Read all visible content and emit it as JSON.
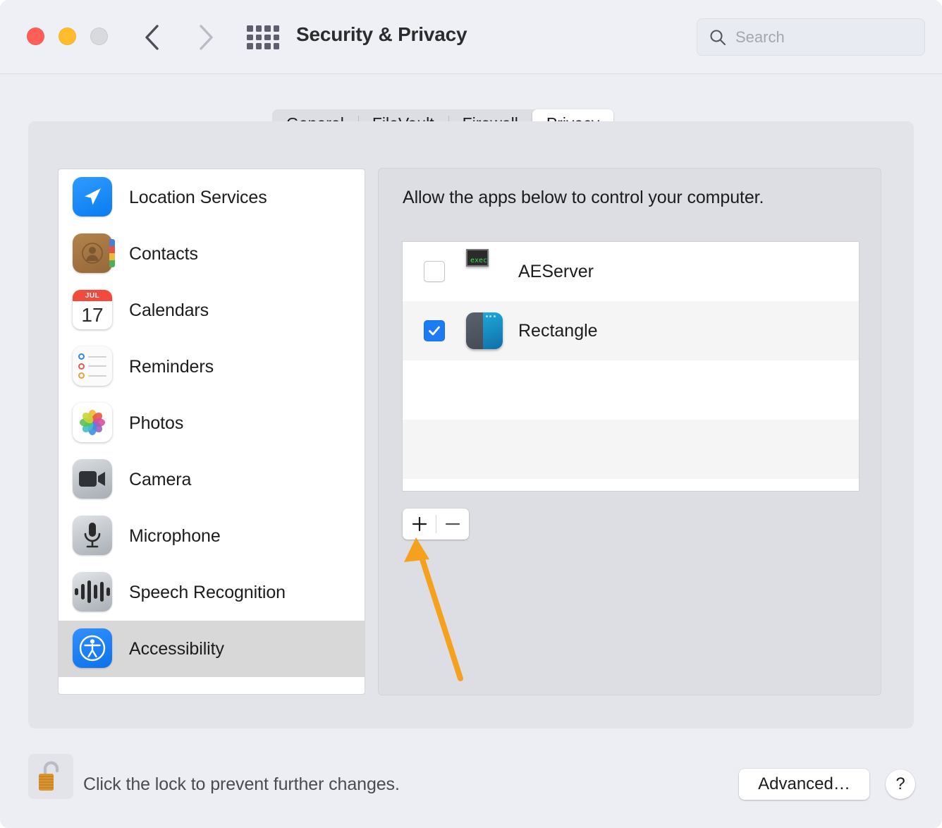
{
  "window": {
    "title": "Security & Privacy",
    "traffic_lights": [
      {
        "name": "close",
        "color": "#ff5f57"
      },
      {
        "name": "minimize",
        "color": "#ffbd2e"
      },
      {
        "name": "zoom",
        "color": "#d8dade"
      }
    ],
    "nav": {
      "back_icon": "chevron-left-icon",
      "forward_icon": "chevron-right-icon"
    },
    "grid_icon": "grid-apps-icon"
  },
  "search": {
    "value": "",
    "placeholder": "Search",
    "icon": "search-icon"
  },
  "tabs": [
    {
      "label": "General",
      "active": false
    },
    {
      "label": "FileVault",
      "active": false
    },
    {
      "label": "Firewall",
      "active": false
    },
    {
      "label": "Privacy",
      "active": true
    }
  ],
  "sidebar": {
    "items": [
      {
        "label": "Location Services",
        "icon": "location-services-icon",
        "selected": false
      },
      {
        "label": "Contacts",
        "icon": "contacts-icon",
        "selected": false
      },
      {
        "label": "Calendars",
        "icon": "calendar-icon",
        "selected": false,
        "month": "JUL",
        "day": "17"
      },
      {
        "label": "Reminders",
        "icon": "reminders-icon",
        "selected": false
      },
      {
        "label": "Photos",
        "icon": "photos-icon",
        "selected": false
      },
      {
        "label": "Camera",
        "icon": "camera-icon",
        "selected": false
      },
      {
        "label": "Microphone",
        "icon": "microphone-icon",
        "selected": false
      },
      {
        "label": "Speech Recognition",
        "icon": "speech-recognition-icon",
        "selected": false
      },
      {
        "label": "Accessibility",
        "icon": "accessibility-icon",
        "selected": true
      }
    ]
  },
  "main": {
    "description": "Allow the apps below to control your computer.",
    "apps": [
      {
        "name": "AEServer",
        "checked": false,
        "icon": "aeserver-icon",
        "icon_text": "exec"
      },
      {
        "name": "Rectangle",
        "checked": true,
        "icon": "rectangle-icon"
      }
    ],
    "add_button_label": "+",
    "remove_button_label": "—"
  },
  "footer": {
    "lock_icon": "unlocked-padlock-icon",
    "lock_text": "Click the lock to prevent further changes.",
    "advanced_label": "Advanced…",
    "help_label": "?"
  },
  "annotation": {
    "arrow_color": "#f5a11e",
    "points_at": "add-app-button"
  },
  "colors": {
    "accent_blue": "#1d7cf5",
    "window_chrome": "#eef0f6",
    "panel_bg": "#e3e4e9",
    "selected_row": "#d8d8d8",
    "annotation_orange": "#f5a11e"
  }
}
